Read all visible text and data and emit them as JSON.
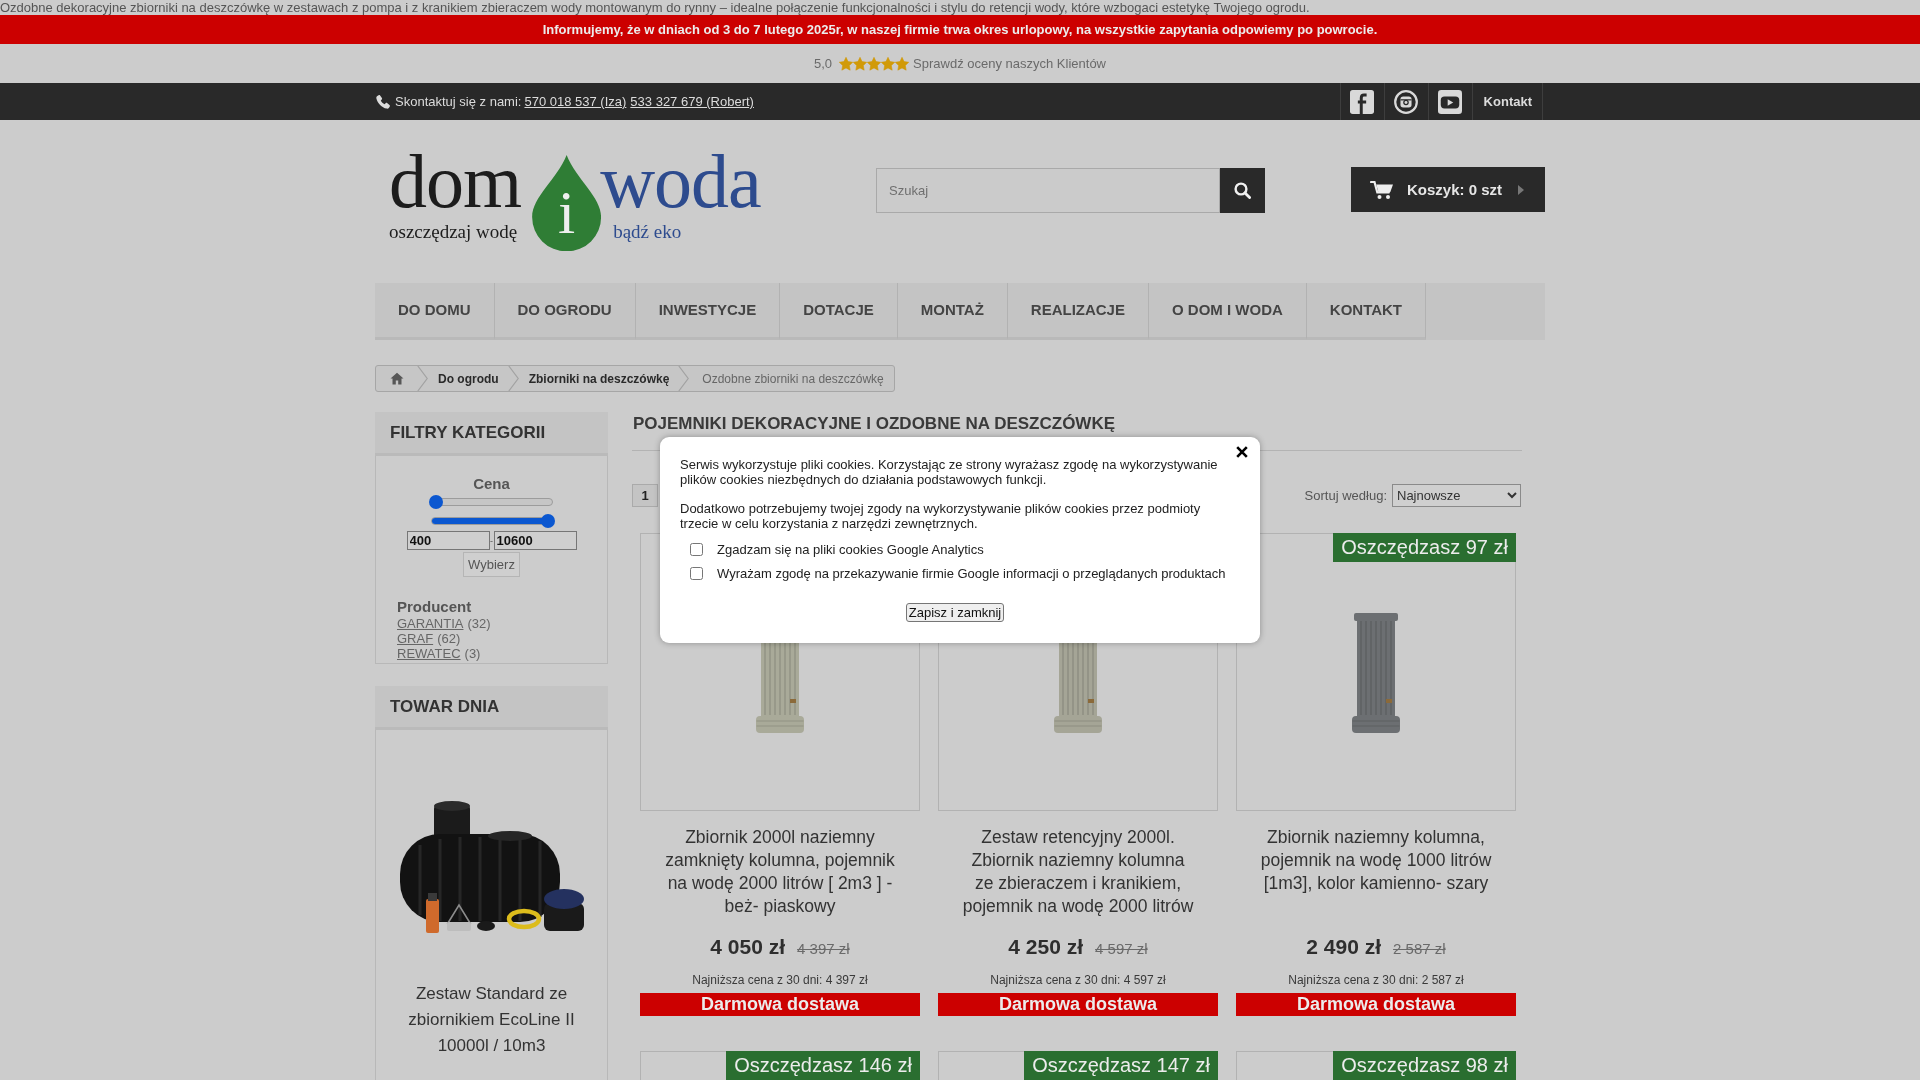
{
  "intro_text": "Ozdobne dekoracyjne zbiorniki na deszczówkę w zestawach z pompa i z kranikiem zbieraczem wody montowanym do rynny – idealne połączenie funkcjonalności i stylu do retencji wody, które wzbogaci estetykę Twojego ogrodu.",
  "notice": "Informujemy, że w dniach od 3 do 7 lutego 2025r, w naszej firmie trwa okres urlopowy, na wszystkie zapytania odpowiemy po powrocie.",
  "rating": {
    "score": "5,0",
    "stars": 5,
    "link": "Sprawdź oceny naszych Klientów"
  },
  "contact_bar": {
    "label": "Skontaktuj się z nami:",
    "phones": [
      "570 018 537 (Iza)",
      "533 327 679 (Robert)"
    ],
    "social": [
      {
        "kind": "facebook"
      },
      {
        "kind": "instagram"
      },
      {
        "kind": "youtube"
      }
    ],
    "link": "Kontakt"
  },
  "logo": {
    "left_word": "dom",
    "left_tagline": "oszczędzaj wodę",
    "drop_letter": "i",
    "right_word": "woda",
    "right_tagline": "bądź eko"
  },
  "search": {
    "placeholder": "Szukaj"
  },
  "cart": {
    "label": "Koszyk: 0 szt"
  },
  "nav": [
    "DO DOMU",
    "DO OGRODU",
    "INWESTYCJE",
    "DOTACJE",
    "MONTAŻ",
    "REALIZACJE",
    "O DOM I WODA",
    "KONTAKT"
  ],
  "breadcrumb": {
    "items": [
      "Do ogrodu",
      "Zbiorniki na deszczówkę"
    ],
    "current": "Ozdobne zbiorniki na deszczówkę"
  },
  "sidebar": {
    "filter": {
      "title": "FILTRY KATEGORII",
      "price": {
        "label": "Cena",
        "sliders": [
          {
            "level": 0
          },
          {
            "level": 1
          }
        ],
        "min": "400",
        "separator": "-",
        "max": "10600",
        "button": "Wybierz"
      },
      "producer": {
        "title": "Producent",
        "items": [
          {
            "label": "GARANTIA",
            "count": "(32)"
          },
          {
            "label": "GRAF",
            "count": "(62)"
          },
          {
            "label": "REWATEC",
            "count": "(3)"
          }
        ]
      }
    },
    "deal": {
      "title": "TOWAR DNIA",
      "product": "Zestaw Standard ze zbiornikiem EcoLine II 10000l / 10m3"
    }
  },
  "main": {
    "title": "POJEMNIKI DEKORACYJNE I OZDOBNE NA DESZCZÓWKĘ",
    "pages": [
      {
        "label": "1",
        "selected": true
      }
    ],
    "sort": {
      "label": "Sortuj według:",
      "value": "Najnowsze"
    },
    "products": [
      {
        "color": "#a9aa99",
        "title": "Zbiornik 2000l naziemny zamknięty kolumna, pojemnik na wodę 2000 litrów [ 2m3 ] - beż- piaskowy",
        "price": "4 050 zł",
        "old_price": "4 397 zł",
        "lowest_price": "Najniższa cena z 30 dni: 4 397 zł",
        "shipping": "Darmowa dostawa"
      },
      {
        "color": "#a5a596",
        "title": "Zestaw retencyjny 2000l. Zbiornik naziemny kolumna ze zbieraczem i kranikiem, pojemnik na wodę 2000 litrów",
        "price": "4 250 zł",
        "old_price": "4 597 zł",
        "lowest_price": "Najniższa cena z 30 dni: 4 597 zł",
        "shipping": "Darmowa dostawa"
      },
      {
        "badge": "Oszczędzasz 97 zł",
        "color": "#6c6f72",
        "title": "Zbiornik naziemny kolumna, pojemnik na wodę 1000 litrów [1m3], kolor kamienno- szary",
        "price": "2 490 zł",
        "old_price": "2 587 zł",
        "lowest_price": "Najniższa cena z 30 dni: 2 587 zł",
        "shipping": "Darmowa dostawa"
      },
      {
        "badge": "Oszczędzasz 146 zł"
      },
      {
        "badge": "Oszczędzasz 147 zł"
      },
      {
        "badge": "Oszczędzasz 98 zł"
      }
    ]
  },
  "cookie_dialog": {
    "paragraphs": [
      "Serwis wykorzystuje pliki cookies. Korzystając ze strony wyrażasz zgodę na wykorzystywanie plików cookies niezbędnych do działania podstawowych funkcji.",
      "Dodatkowo potrzebujemy twojej zgody na wykorzystywanie plików cookies przez podmioty trzecie w celu korzystania z narzędzi zewnętrznych."
    ],
    "options": [
      {
        "label": "Zgadzam się na pliki cookies Google Analytics",
        "checked": false
      },
      {
        "label": "Wyrażam zgodę na przekazywanie firmie Google informacji o przeglądanych produktach",
        "checked": false
      }
    ],
    "button": "Zapisz i zamknij"
  }
}
